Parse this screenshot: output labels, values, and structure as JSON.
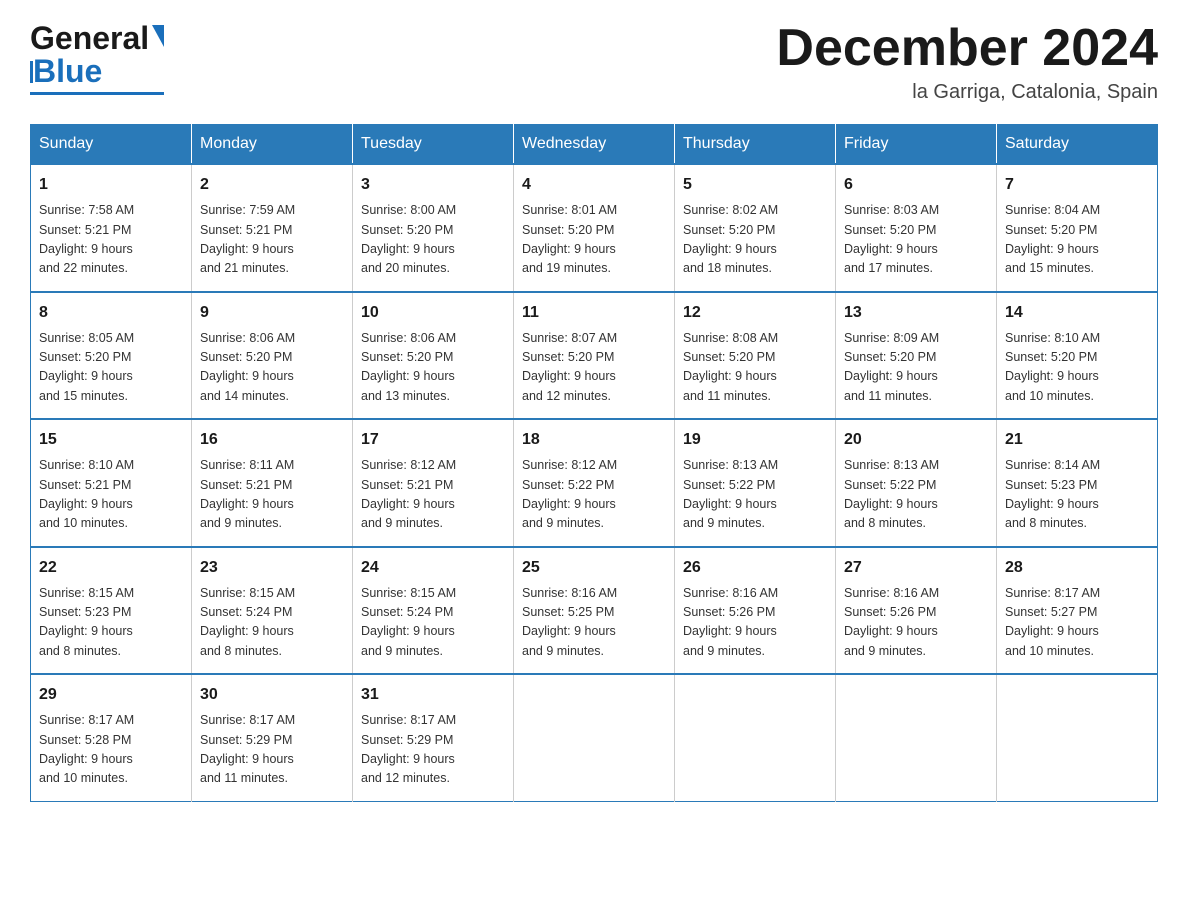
{
  "header": {
    "logo_general": "General",
    "logo_blue": "Blue",
    "month_title": "December 2024",
    "location": "la Garriga, Catalonia, Spain"
  },
  "days_of_week": [
    "Sunday",
    "Monday",
    "Tuesday",
    "Wednesday",
    "Thursday",
    "Friday",
    "Saturday"
  ],
  "weeks": [
    [
      {
        "day": "1",
        "sunrise": "7:58 AM",
        "sunset": "5:21 PM",
        "daylight": "9 hours and 22 minutes."
      },
      {
        "day": "2",
        "sunrise": "7:59 AM",
        "sunset": "5:21 PM",
        "daylight": "9 hours and 21 minutes."
      },
      {
        "day": "3",
        "sunrise": "8:00 AM",
        "sunset": "5:20 PM",
        "daylight": "9 hours and 20 minutes."
      },
      {
        "day": "4",
        "sunrise": "8:01 AM",
        "sunset": "5:20 PM",
        "daylight": "9 hours and 19 minutes."
      },
      {
        "day": "5",
        "sunrise": "8:02 AM",
        "sunset": "5:20 PM",
        "daylight": "9 hours and 18 minutes."
      },
      {
        "day": "6",
        "sunrise": "8:03 AM",
        "sunset": "5:20 PM",
        "daylight": "9 hours and 17 minutes."
      },
      {
        "day": "7",
        "sunrise": "8:04 AM",
        "sunset": "5:20 PM",
        "daylight": "9 hours and 15 minutes."
      }
    ],
    [
      {
        "day": "8",
        "sunrise": "8:05 AM",
        "sunset": "5:20 PM",
        "daylight": "9 hours and 15 minutes."
      },
      {
        "day": "9",
        "sunrise": "8:06 AM",
        "sunset": "5:20 PM",
        "daylight": "9 hours and 14 minutes."
      },
      {
        "day": "10",
        "sunrise": "8:06 AM",
        "sunset": "5:20 PM",
        "daylight": "9 hours and 13 minutes."
      },
      {
        "day": "11",
        "sunrise": "8:07 AM",
        "sunset": "5:20 PM",
        "daylight": "9 hours and 12 minutes."
      },
      {
        "day": "12",
        "sunrise": "8:08 AM",
        "sunset": "5:20 PM",
        "daylight": "9 hours and 11 minutes."
      },
      {
        "day": "13",
        "sunrise": "8:09 AM",
        "sunset": "5:20 PM",
        "daylight": "9 hours and 11 minutes."
      },
      {
        "day": "14",
        "sunrise": "8:10 AM",
        "sunset": "5:20 PM",
        "daylight": "9 hours and 10 minutes."
      }
    ],
    [
      {
        "day": "15",
        "sunrise": "8:10 AM",
        "sunset": "5:21 PM",
        "daylight": "9 hours and 10 minutes."
      },
      {
        "day": "16",
        "sunrise": "8:11 AM",
        "sunset": "5:21 PM",
        "daylight": "9 hours and 9 minutes."
      },
      {
        "day": "17",
        "sunrise": "8:12 AM",
        "sunset": "5:21 PM",
        "daylight": "9 hours and 9 minutes."
      },
      {
        "day": "18",
        "sunrise": "8:12 AM",
        "sunset": "5:22 PM",
        "daylight": "9 hours and 9 minutes."
      },
      {
        "day": "19",
        "sunrise": "8:13 AM",
        "sunset": "5:22 PM",
        "daylight": "9 hours and 9 minutes."
      },
      {
        "day": "20",
        "sunrise": "8:13 AM",
        "sunset": "5:22 PM",
        "daylight": "9 hours and 8 minutes."
      },
      {
        "day": "21",
        "sunrise": "8:14 AM",
        "sunset": "5:23 PM",
        "daylight": "9 hours and 8 minutes."
      }
    ],
    [
      {
        "day": "22",
        "sunrise": "8:15 AM",
        "sunset": "5:23 PM",
        "daylight": "9 hours and 8 minutes."
      },
      {
        "day": "23",
        "sunrise": "8:15 AM",
        "sunset": "5:24 PM",
        "daylight": "9 hours and 8 minutes."
      },
      {
        "day": "24",
        "sunrise": "8:15 AM",
        "sunset": "5:24 PM",
        "daylight": "9 hours and 9 minutes."
      },
      {
        "day": "25",
        "sunrise": "8:16 AM",
        "sunset": "5:25 PM",
        "daylight": "9 hours and 9 minutes."
      },
      {
        "day": "26",
        "sunrise": "8:16 AM",
        "sunset": "5:26 PM",
        "daylight": "9 hours and 9 minutes."
      },
      {
        "day": "27",
        "sunrise": "8:16 AM",
        "sunset": "5:26 PM",
        "daylight": "9 hours and 9 minutes."
      },
      {
        "day": "28",
        "sunrise": "8:17 AM",
        "sunset": "5:27 PM",
        "daylight": "9 hours and 10 minutes."
      }
    ],
    [
      {
        "day": "29",
        "sunrise": "8:17 AM",
        "sunset": "5:28 PM",
        "daylight": "9 hours and 10 minutes."
      },
      {
        "day": "30",
        "sunrise": "8:17 AM",
        "sunset": "5:29 PM",
        "daylight": "9 hours and 11 minutes."
      },
      {
        "day": "31",
        "sunrise": "8:17 AM",
        "sunset": "5:29 PM",
        "daylight": "9 hours and 12 minutes."
      },
      null,
      null,
      null,
      null
    ]
  ],
  "labels": {
    "sunrise": "Sunrise:",
    "sunset": "Sunset:",
    "daylight": "Daylight:"
  }
}
